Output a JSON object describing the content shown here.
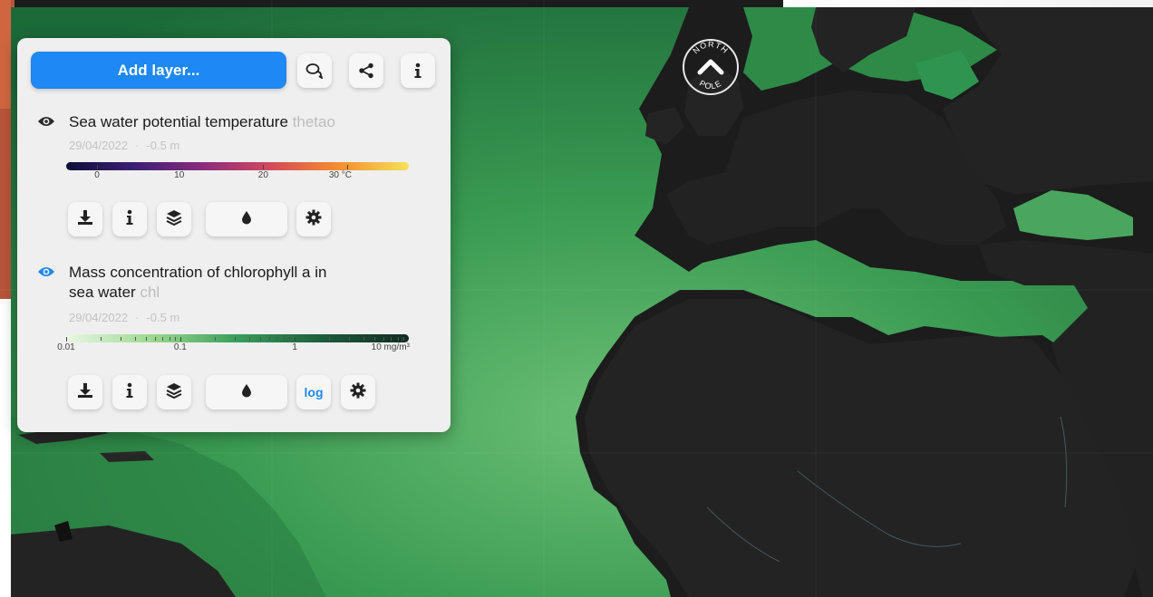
{
  "map": {
    "compass_top": "NORTH",
    "compass_bottom": "POLE"
  },
  "panel": {
    "add_layer_label": "Add layer...",
    "top_icons": [
      "chat-icon",
      "share-icon",
      "info-icon"
    ]
  },
  "layers": [
    {
      "title": "Sea water potential temperature",
      "abbr": "thetao",
      "date": "29/04/2022",
      "depth": "-0.5 m",
      "visible": true,
      "ticks": [
        "0",
        "10",
        "20",
        "30 °C"
      ],
      "colors": [
        "#0c1038",
        "#3c1f74",
        "#8a2b7e",
        "#d44a5a",
        "#f5902f",
        "#f6e15a"
      ],
      "tools": [
        "download-icon",
        "info-icon",
        "layers-icon",
        "drop-icon",
        "gear-icon"
      ]
    },
    {
      "title_line1": "Mass concentration of chlorophyll a in",
      "title_line2": "sea water",
      "abbr": "chl",
      "date": "29/04/2022",
      "depth": "-0.5 m",
      "visible": true,
      "ticks": [
        "0.01",
        "0.1",
        "1",
        "10 mg/m³"
      ],
      "colors": [
        "#eaf7e3",
        "#9bd98f",
        "#3a9d5a",
        "#1d5c3b",
        "#0f2b22"
      ],
      "scale_label": "log",
      "tools": [
        "download-icon",
        "info-icon",
        "layers-icon",
        "drop-icon",
        "gear-icon"
      ]
    }
  ]
}
